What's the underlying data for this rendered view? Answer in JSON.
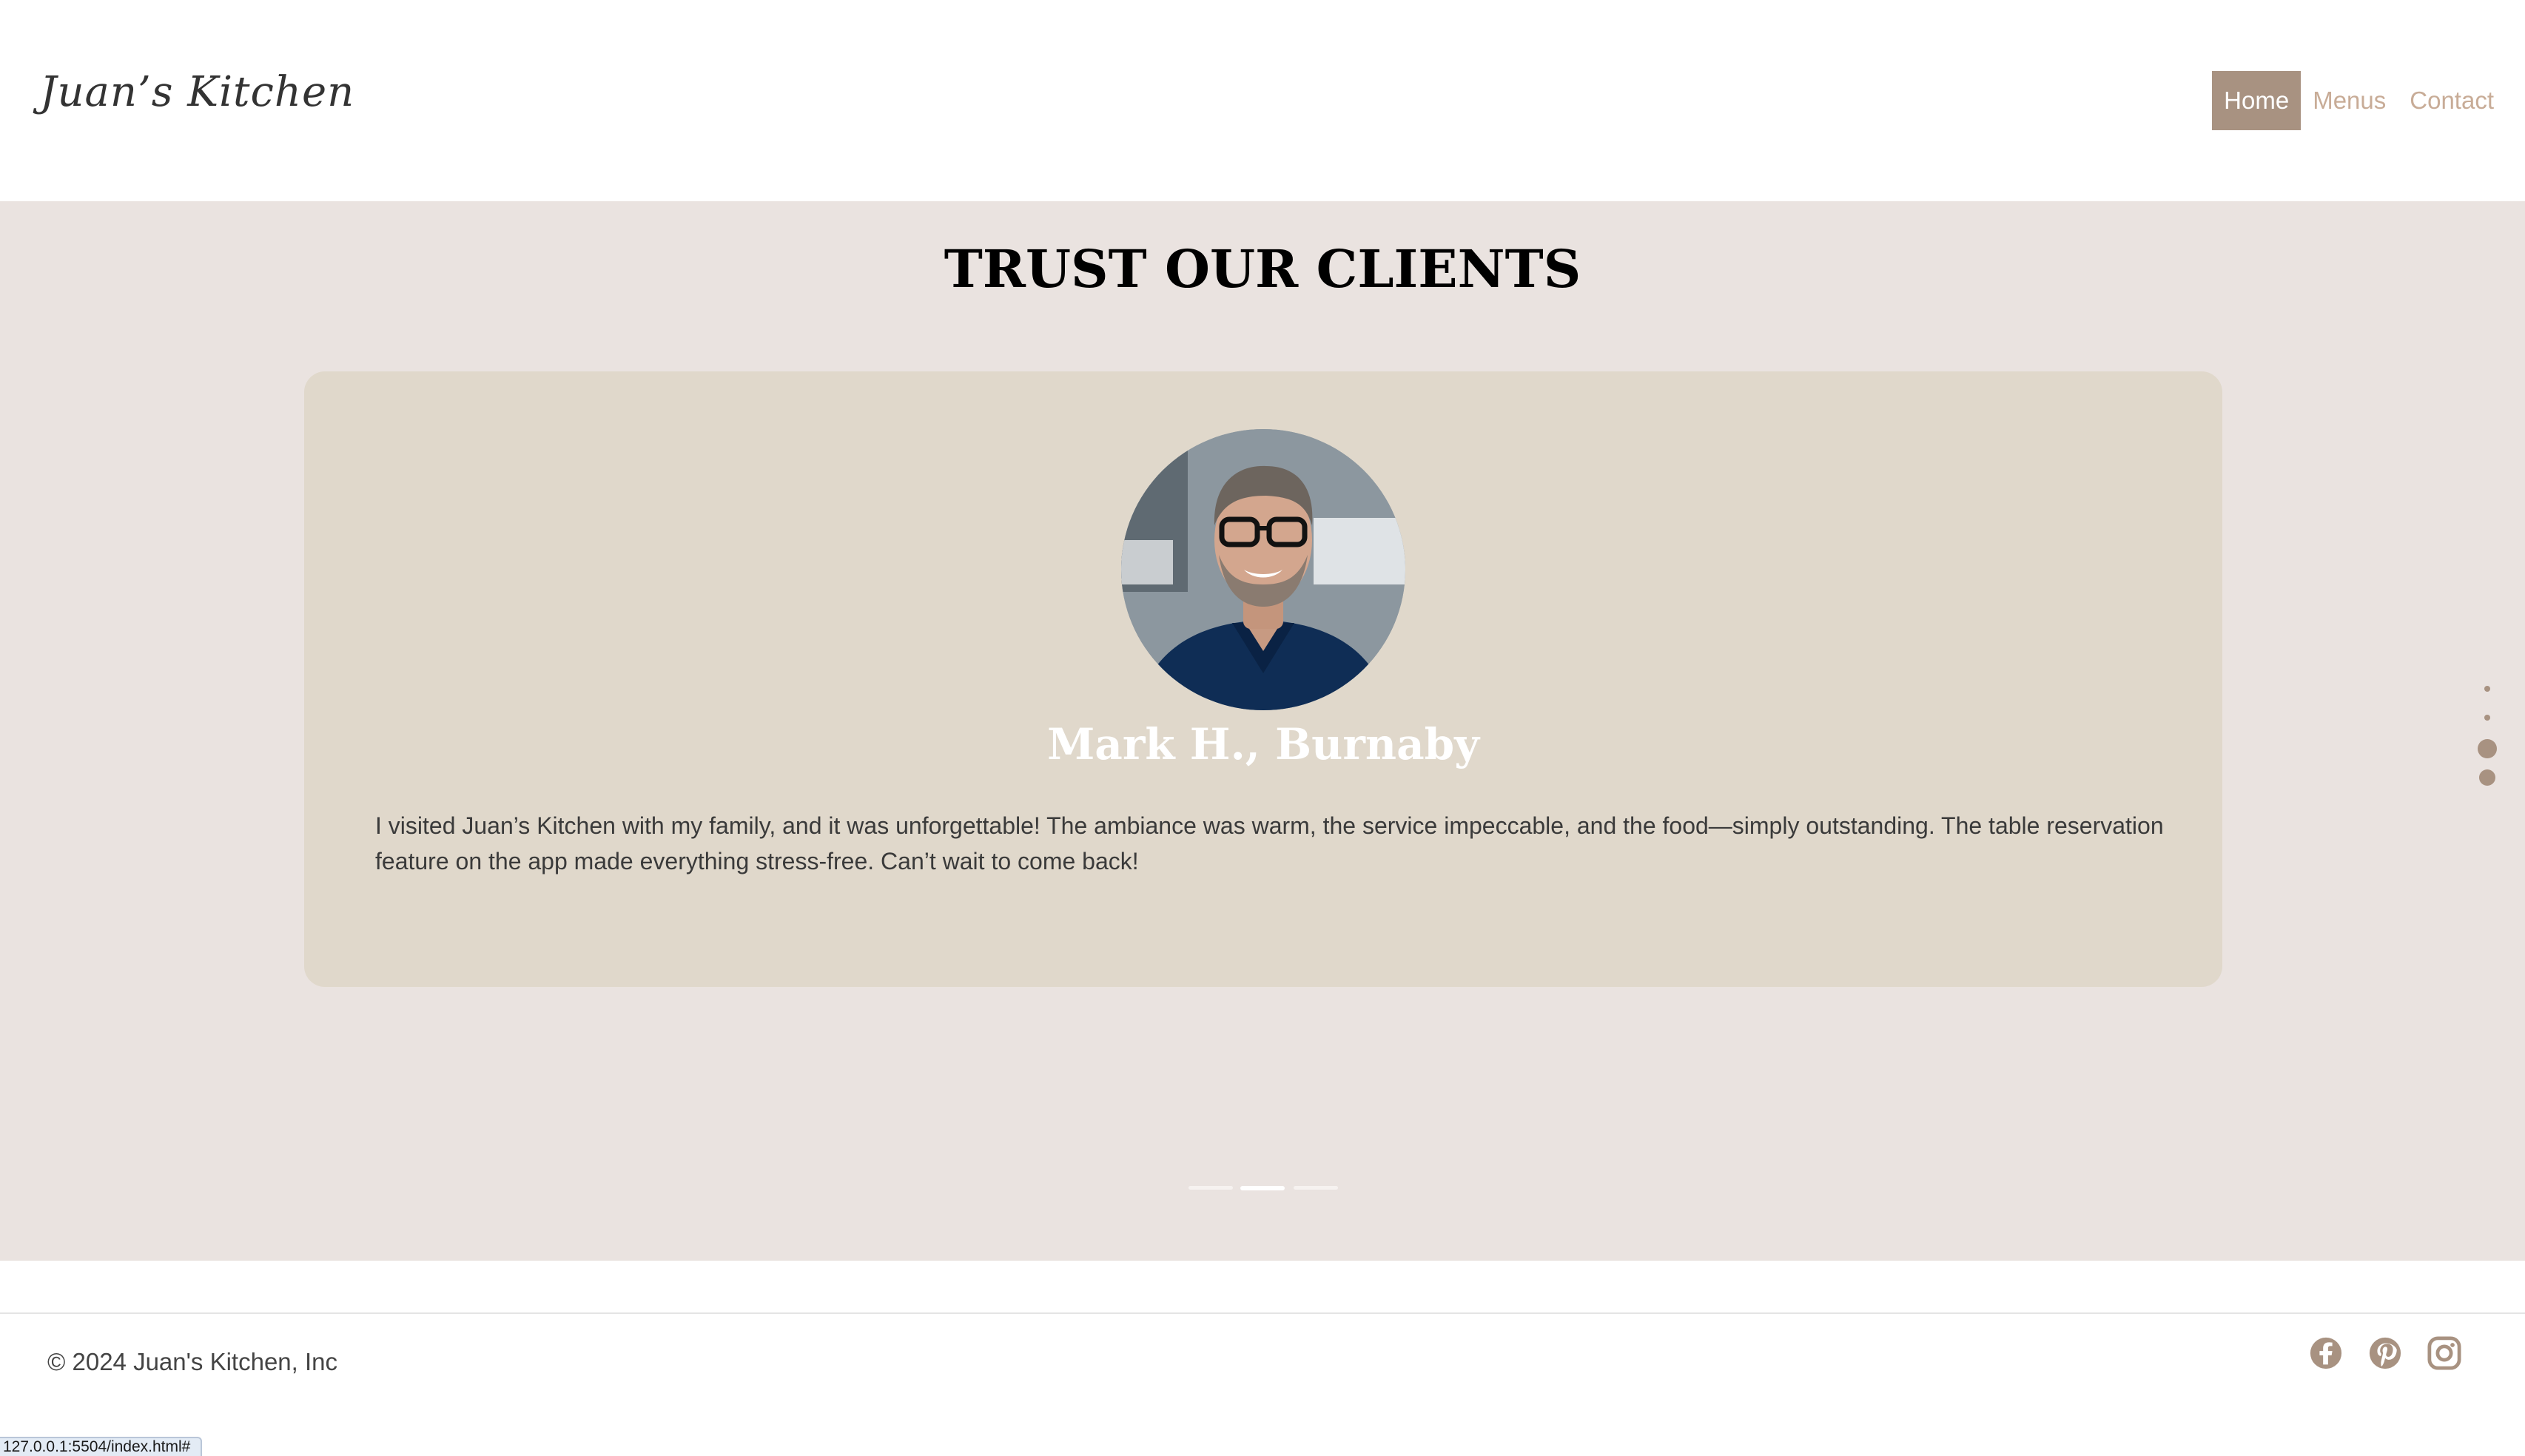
{
  "brand": {
    "logo_text": "Juan’s Kitchen"
  },
  "nav": {
    "items": [
      {
        "label": "Home",
        "active": true
      },
      {
        "label": "Menus",
        "active": false
      },
      {
        "label": "Contact",
        "active": false
      }
    ]
  },
  "testimonials": {
    "title": "TRUST OUR CLIENTS",
    "card": {
      "avatar_alt": "Smiling man with glasses in a navy shirt",
      "name": "Mark H., Burnaby",
      "quote": "I visited Juan’s Kitchen with my family, and it was unforgettable! The ambiance was warm, the service impeccable, and the food—simply outstanding. The table reservation feature on the app made everything stress-free. Can’t wait to come back!"
    },
    "slider": {
      "count": 3,
      "active_index": 1
    },
    "section_dots": {
      "count": 4,
      "active_index": 2
    }
  },
  "footer": {
    "copyright": "© 2024 Juan's Kitchen, Inc",
    "social": [
      "facebook-icon",
      "pinterest-icon",
      "instagram-icon"
    ]
  },
  "status_bar": {
    "url": "127.0.0.1:5504/index.html#"
  },
  "colors": {
    "accent": "#a89281",
    "nav_text": "#c8ac97",
    "section_bg": "#eae3e0",
    "card_bg": "#e0d8cb"
  }
}
